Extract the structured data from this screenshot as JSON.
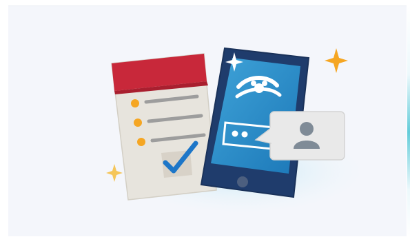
{
  "illustration": {
    "accent_red": "#c8283a",
    "accent_blue": "#2a5c9f",
    "accent_teal": "#3a9fd1",
    "accent_orange": "#f5a623",
    "check_blue": "#1d76c8",
    "icons": {
      "checklist": "checklist-icon",
      "tablet": "tablet-icon",
      "chat": "chat-bubble-icon",
      "user": "user-icon",
      "sparkle": "sparkle-icon",
      "logo": "cruise-logo-icon"
    }
  }
}
